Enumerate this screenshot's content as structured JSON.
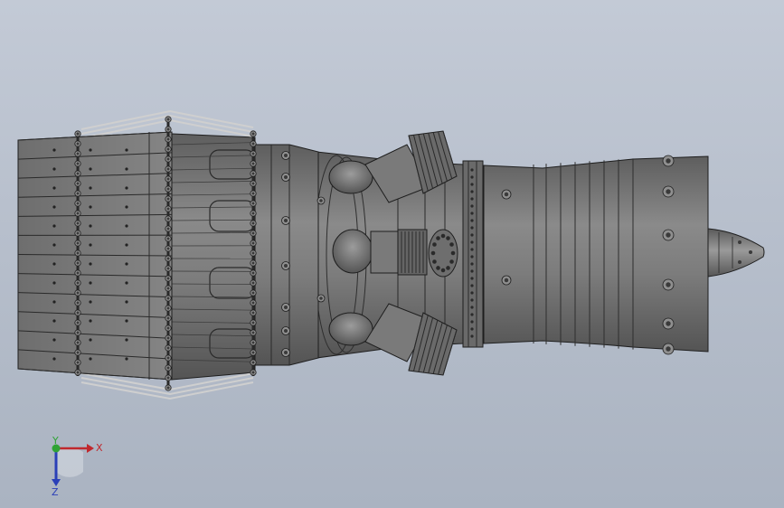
{
  "viewport": {
    "model_name": "turbojet-engine-assembly",
    "colors": {
      "background_top": "#c3cad6",
      "background_bottom": "#aab3c1",
      "model_fill": "#7a7a7a",
      "model_dark": "#4f4f4f",
      "model_light": "#a3a3a3",
      "edge_line": "#1e1e1e"
    }
  },
  "triad": {
    "x_label": "X",
    "y_label": "Y",
    "z_label": "Z",
    "colors": {
      "x": "#c0282d",
      "y": "#2fa335",
      "z": "#2a3fb8"
    }
  }
}
